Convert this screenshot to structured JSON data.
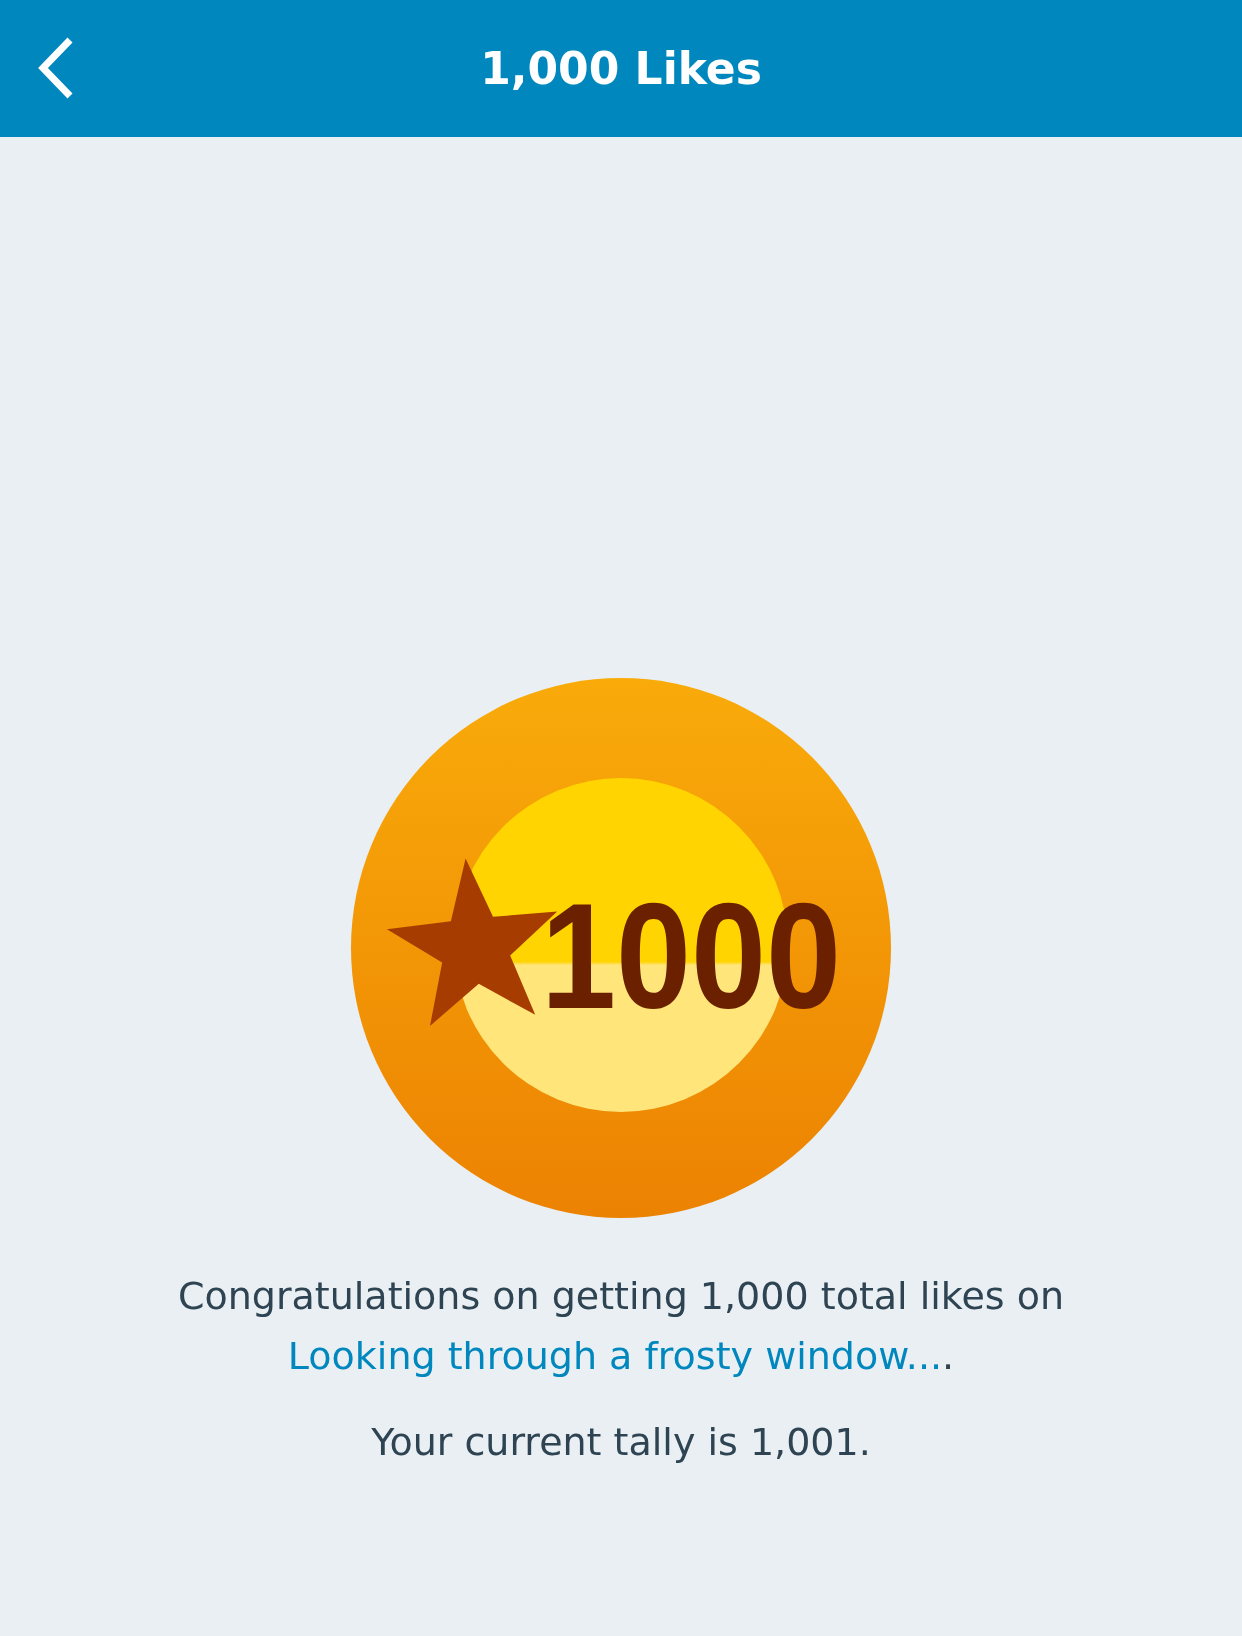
{
  "header": {
    "title": "1,000 Likes"
  },
  "badge": {
    "label": "1000"
  },
  "message": {
    "before": "Congratulations on getting 1,000 total likes on ",
    "link": "Looking through a frosty window...",
    "after": "."
  },
  "tally": "Your current tally is 1,001."
}
